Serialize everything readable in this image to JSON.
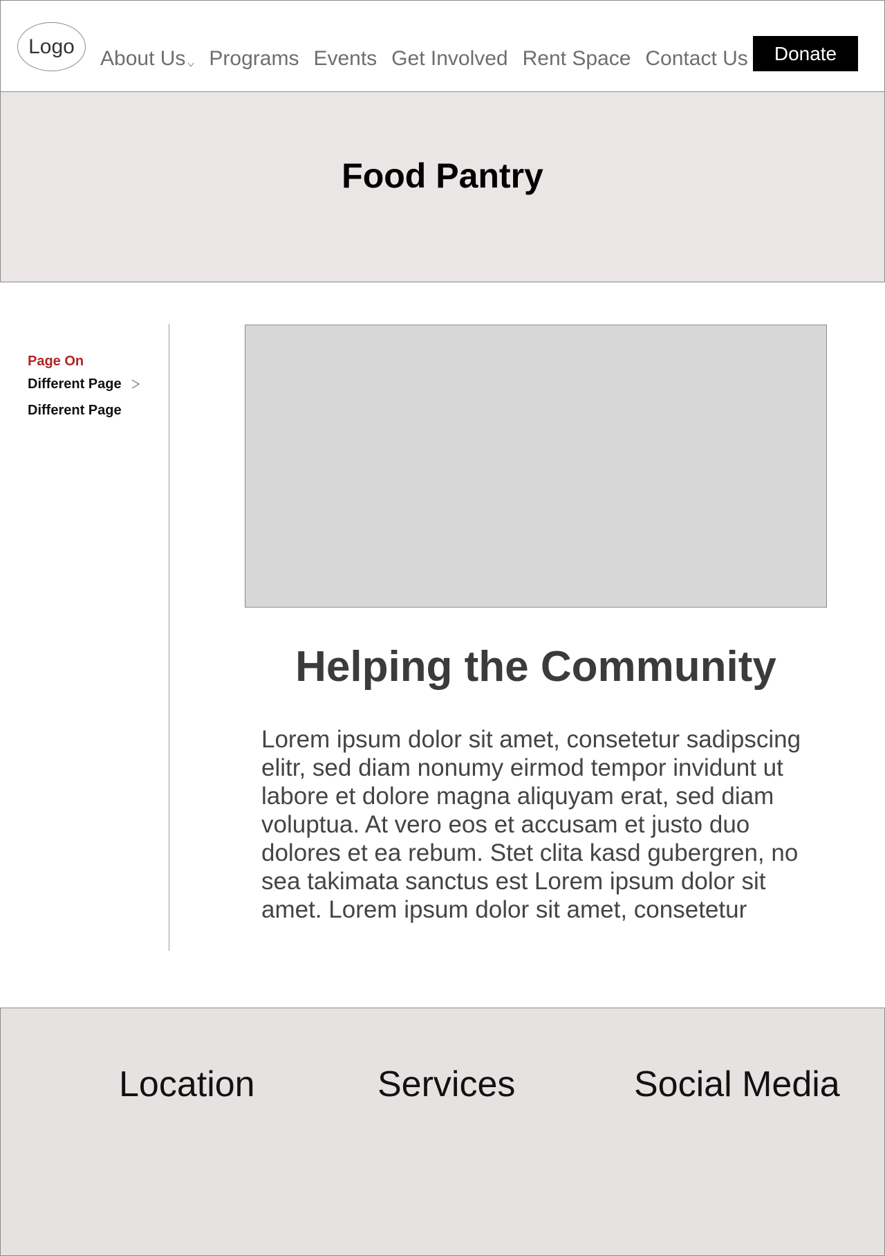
{
  "header": {
    "logo_text": "Logo",
    "nav": [
      {
        "label": "About Us"
      },
      {
        "label": "Programs"
      },
      {
        "label": "Events"
      },
      {
        "label": "Get Involved"
      },
      {
        "label": "Rent Space"
      },
      {
        "label": "Contact Us"
      }
    ],
    "donate_label": "Donate"
  },
  "hero": {
    "title": "Food Pantry"
  },
  "sidebar": {
    "items": [
      {
        "label": "Page On",
        "active": true
      },
      {
        "label": "Different Page",
        "has_submenu": true
      },
      {
        "label": "Different Page"
      }
    ]
  },
  "main": {
    "heading": "Helping the Community",
    "body": "Lorem ipsum dolor sit amet, consetetur sadipscing elitr, sed diam nonumy eirmod tempor invidunt ut labore et dolore magna aliquyam erat, sed diam voluptua. At vero eos et accusam et justo duo dolores et ea rebum. Stet clita kasd gubergren, no sea takimata sanctus est Lorem ipsum dolor sit amet. Lorem ipsum dolor sit amet, consetetur"
  },
  "footer": {
    "columns": [
      {
        "label": "Location"
      },
      {
        "label": "Services"
      },
      {
        "label": "Social Media"
      }
    ]
  },
  "colors": {
    "active_sidebar": "#b22424",
    "hero_bg": "#e9e6e5",
    "footer_bg": "#e5e2e1",
    "donate_bg": "#000000"
  }
}
